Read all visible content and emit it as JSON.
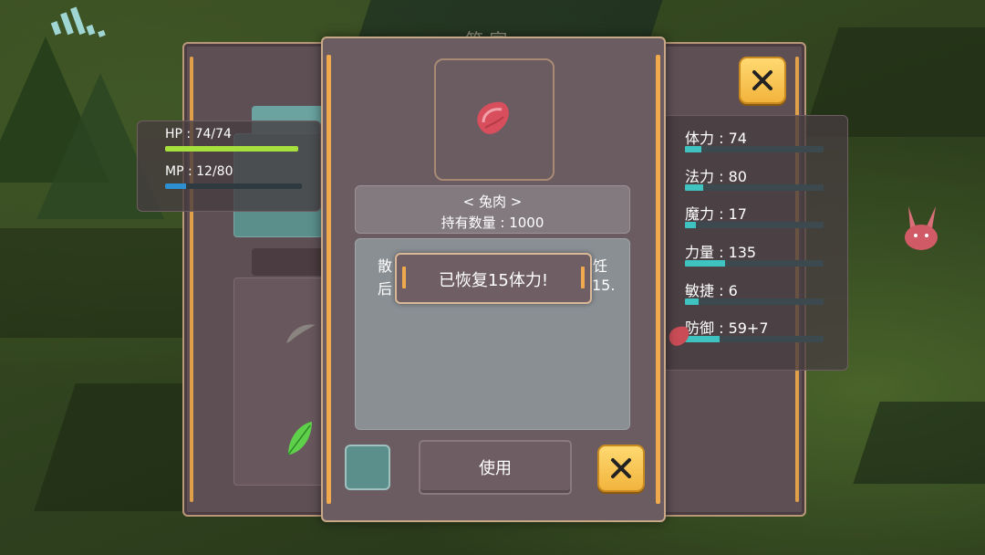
{
  "background_title": "筑 家",
  "player": {
    "hp_label": "HP : 74/74",
    "hp_value": 74,
    "hp_max": 74,
    "hp_color": "#a6e03c",
    "mp_label": "MP : 12/80",
    "mp_value": 12,
    "mp_max": 80,
    "mp_color": "#2e8fd0"
  },
  "attributes": [
    {
      "label": "体力 : 74",
      "fill": 0.12
    },
    {
      "label": "法力 : 80",
      "fill": 0.13
    },
    {
      "label": "魔力 : 17",
      "fill": 0.08
    },
    {
      "label": "力量 : 135",
      "fill": 0.29
    },
    {
      "label": "敏捷 : 6",
      "fill": 0.1
    },
    {
      "label": "防御 : 59+7",
      "fill": 0.25
    }
  ],
  "item": {
    "icon": "meat-icon",
    "name": "< 兔肉 >",
    "quantity": "持有数量 : 1000",
    "desc_line1_start": "散",
    "desc_line1_end": "烹饪",
    "desc_line2_start": "后",
    "desc_line2_end": "15."
  },
  "toast": {
    "message": "已恢复15体力!"
  },
  "buttons": {
    "use_label": "使用"
  },
  "colors": {
    "accent_orange": "#f0a94c",
    "panel": "#6b5c62",
    "teal": "#3fc3c0",
    "close_yellow": "#f7c64e"
  }
}
